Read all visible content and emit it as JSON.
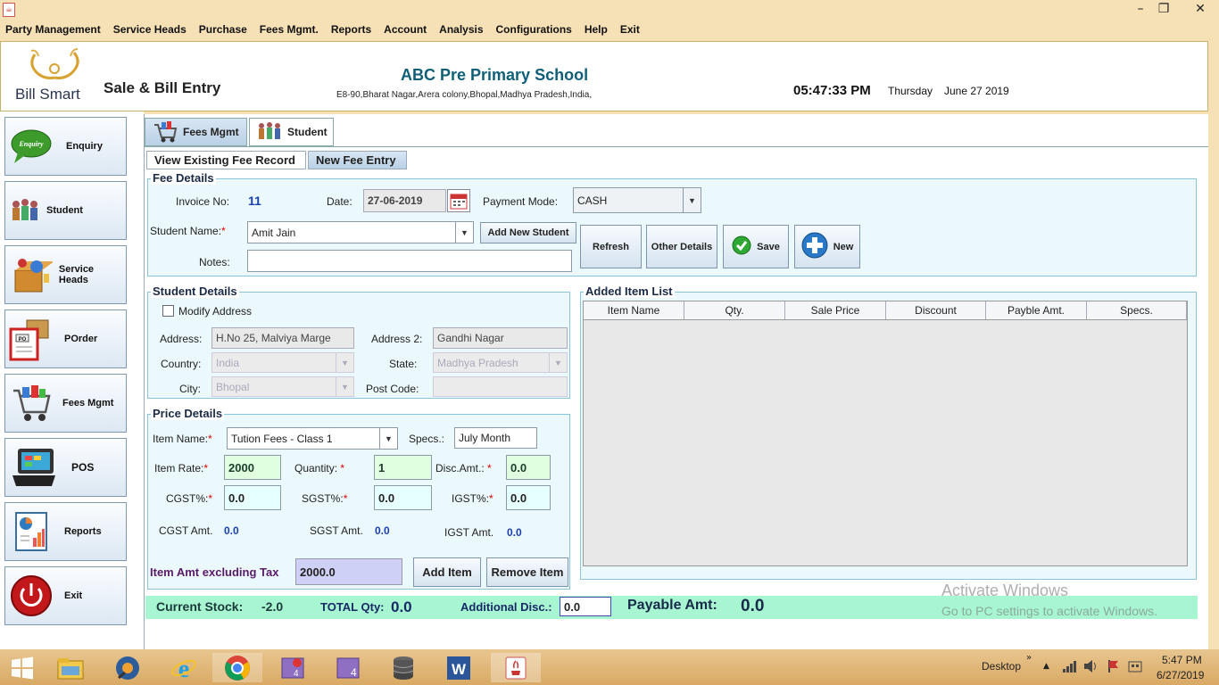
{
  "menu": [
    "Party Management",
    "Service Heads",
    "Purchase",
    "Fees Mgmt.",
    "Reports",
    "Account",
    "Analysis",
    "Configurations",
    "Help",
    "Exit"
  ],
  "header": {
    "logo_text": "Bill Smart",
    "screen_title": "Sale & Bill Entry",
    "school_name": "ABC Pre Primary School",
    "school_address": "E8-90,Bharat Nagar,Arera colony,Bhopal,Madhya Pradesh,India,",
    "time": "05:47:33 PM",
    "day": "Thursday",
    "date": "June 27 2019"
  },
  "sidebar": [
    "Enquiry",
    "Student",
    "Service Heads",
    "POrder",
    "Fees Mgmt",
    "POS",
    "Reports",
    "Exit"
  ],
  "tabs": [
    "Fees Mgmt",
    "Student"
  ],
  "subtabs": [
    "View Existing Fee Record",
    "New Fee Entry"
  ],
  "fee": {
    "title": "Fee Details",
    "invoice_label": "Invoice No:",
    "invoice_value": "11",
    "date_label": "Date:",
    "date_value": "27-06-2019",
    "payment_label": "Payment Mode:",
    "payment_value": "CASH",
    "student_label": "Student Name:",
    "student_value": "Amit Jain",
    "add_student": "Add New Student",
    "notes_label": "Notes:",
    "notes_value": "",
    "btn_refresh": "Refresh",
    "btn_other": "Other Details",
    "btn_save": "Save",
    "btn_new": "New"
  },
  "student": {
    "title": "Student Details",
    "modify_address": "Modify Address",
    "address_label": "Address:",
    "address_value": "H.No 25, Malviya Marge",
    "address2_label": "Address 2:",
    "address2_value": "Gandhi Nagar",
    "country_label": "Country:",
    "country_value": "India",
    "state_label": "State:",
    "state_value": "Madhya Pradesh",
    "city_label": "City:",
    "city_value": "Bhopal",
    "post_label": "Post Code:",
    "post_value": ""
  },
  "price": {
    "title": "Price Details",
    "item_label": "Item Name:",
    "item_value": "Tution Fees - Class 1",
    "specs_label": "Specs.:",
    "specs_value": "July Month",
    "rate_label": "Item Rate:",
    "rate_value": "2000",
    "qty_label": "Quantity:",
    "qty_value": "1",
    "disc_label": "Disc.Amt.:",
    "disc_value": "0.0",
    "cgst_label": "CGST%:",
    "cgst_value": "0.0",
    "sgst_label": "SGST%:",
    "sgst_value": "0.0",
    "igst_label": "IGST%:",
    "igst_value": "0.0",
    "cgst_amt_label": "CGST Amt.",
    "cgst_amt_value": "0.0",
    "sgst_amt_label": "SGST Amt.",
    "sgst_amt_value": "0.0",
    "igst_amt_label": "IGST Amt.",
    "igst_amt_value": "0.0",
    "excl_label": "Item Amt excluding Tax",
    "excl_value": "2000.0",
    "btn_add": "Add Item",
    "btn_remove": "Remove Item"
  },
  "items": {
    "title": "Added Item List",
    "columns": [
      "Item Name",
      "Qty.",
      "Sale Price",
      "Discount",
      "Payble Amt.",
      "Specs."
    ]
  },
  "footer": {
    "stock_label": "Current Stock:",
    "stock_value": "-2.0",
    "total_qty_label": "TOTAL Qty:",
    "total_qty_value": "0.0",
    "add_disc_label": "Additional Disc.:",
    "add_disc_value": "0.0",
    "payable_label": "Payable Amt:",
    "payable_value": "0.0"
  },
  "watermark": {
    "line1": "Activate Windows",
    "line2": "Go to PC settings to activate Windows."
  },
  "taskbar": {
    "desktop_label": "Desktop",
    "time": "5:47 PM",
    "date": "6/27/2019"
  }
}
